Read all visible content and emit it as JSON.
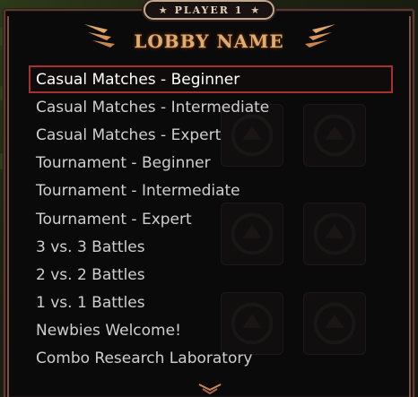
{
  "header": {
    "player_tab": "PLAYER 1",
    "star_icon": "★",
    "title": "LOBBY NAME"
  },
  "lobbies": [
    {
      "label": "Casual Matches - Beginner",
      "selected": true
    },
    {
      "label": "Casual Matches - Intermediate",
      "selected": false
    },
    {
      "label": "Casual Matches - Expert",
      "selected": false
    },
    {
      "label": "Tournament - Beginner",
      "selected": false
    },
    {
      "label": "Tournament - Intermediate",
      "selected": false
    },
    {
      "label": "Tournament - Expert",
      "selected": false
    },
    {
      "label": "3 vs. 3 Battles",
      "selected": false
    },
    {
      "label": "2 vs. 2 Battles",
      "selected": false
    },
    {
      "label": "1 vs. 1 Battles",
      "selected": false
    },
    {
      "label": "Newbies Welcome!",
      "selected": false
    },
    {
      "label": "Combo Research Laboratory",
      "selected": false
    }
  ],
  "colors": {
    "title": "#e0ad70",
    "selection_border": "#a6312f",
    "item_text": "#cfcfcf",
    "panel_border": "#5a3a30"
  },
  "icons": [
    "star-icon",
    "wing-ornament-icon",
    "scroll-down-icon",
    "emblem-icon"
  ]
}
